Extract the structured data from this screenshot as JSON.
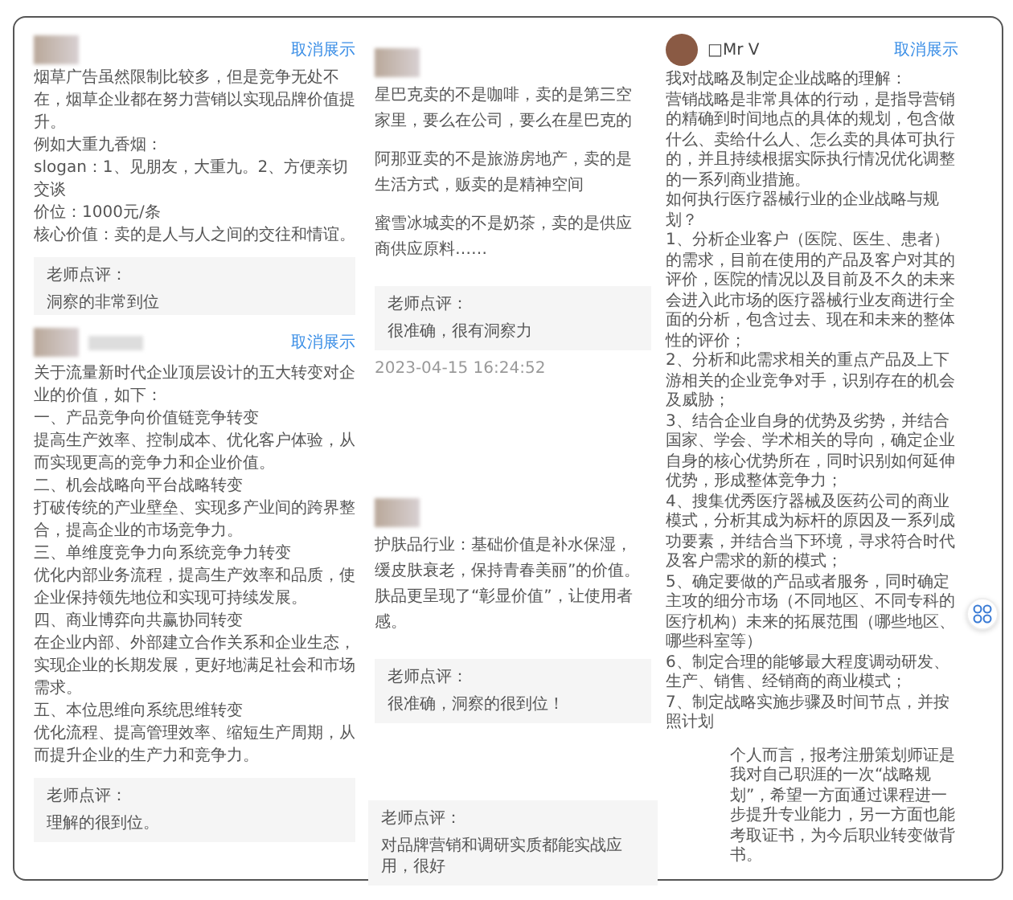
{
  "cards": [
    {
      "kind": "blurred",
      "name_blurred": false,
      "hide_link": "取消展示",
      "paragraphs": [
        "烟草广告虽然限制比较多，但是竞争无处不在，烟草企业都在努力营销以实现品牌价值提升。",
        "例如大重九香烟：",
        "slogan：1、见朋友，大重九。2、方便亲切交谈",
        "价位：1000元/条",
        "核心价值：卖的是人与人之间的交往和情谊。"
      ],
      "comment": {
        "label": "老师点评：",
        "text": "洞察的非常到位"
      }
    },
    {
      "kind": "blurred",
      "name_blurred": true,
      "hide_link": "取消展示",
      "paragraphs": [
        "关于流量新时代企业顶层设计的五大转变对企业的价值，如下：",
        "一、产品竞争向价值链竞争转变",
        "提高生产效率、控制成本、优化客户体验，从而实现更高的竞争力和企业价值。",
        "二、机会战略向平台战略转变",
        "打破传统的产业壁垒、实现多产业间的跨界整合，提高企业的市场竞争力。",
        "三、单维度竞争力向系统竞争力转变",
        "优化内部业务流程，提高生产效率和品质，使企业保持领先地位和实现可持续发展。",
        "四、商业博弈向共赢协同转变",
        "在企业内部、外部建立合作关系和企业生态，实现企业的长期发展，更好地满足社会和市场需求。",
        "五、本位思维向系统思维转变",
        "优化流程、提高管理效率、缩短生产周期，从而提升企业的生产力和竞争力。"
      ],
      "comment": {
        "label": "老师点评：",
        "text": "理解的很到位。"
      }
    },
    {
      "kind": "blurred",
      "name_blurred": false,
      "line_groups": [
        [
          "星巴克卖的不是咖啡，卖的是第三空",
          "家里，要么在公司，要么在星巴克的"
        ],
        [
          "阿那亚卖的不是旅游房地产，卖的是",
          "生活方式，贩卖的是精神空间"
        ],
        [
          "蜜雪冰城卖的不是奶茶，卖的是供应",
          "商供应原料……"
        ]
      ],
      "comment": {
        "label": "老师点评：",
        "text": "很准确，很有洞察力"
      },
      "time": "2023-04-15 16:24:52"
    },
    {
      "kind": "blurred",
      "name_blurred": false,
      "line_groups": [
        [
          "护肤品行业：基础价值是补水保湿，",
          "缓皮肤衰老，保持青春美丽”的价值。",
          "肤品更呈现了“彰显价值”，让使用者",
          "感。"
        ]
      ],
      "comment": {
        "label": "老师点评：",
        "text": "很准确，洞察的很到位！"
      }
    },
    {
      "kind": "photo",
      "name_blurred": false,
      "author": "□Mr V",
      "hide_link": "取消展示",
      "paragraphs": [
        "我对战略及制定企业战略的理解：",
        "营销战略是非常具体的行动，是指导营销的精确到时间地点的具体的规划，包含做什么、卖给什么人、怎么卖的具体可执行的，并且持续根据实际执行情况优化调整的一系列商业措施。",
        "如何执行医疗器械行业的企业战略与规划？",
        "1、分析企业客户（医院、医生、患者）的需求，目前在使用的产品及客户对其的评价，医院的情况以及目前及不久的未来会进入此市场的医疗器械行业友商进行全面的分析，包含过去、现在和未来的整体性的评价；",
        "2、分析和此需求相关的重点产品及上下游相关的企业竞争对手，识别存在的机会及威胁；",
        "3、结合企业自身的优势及劣势，并结合国家、学会、学术相关的导向，确定企业自身的核心优势所在，同时识别如何延伸优势，形成整体竞争力；",
        "4、搜集优秀医疗器械及医药公司的商业模式，分析其成为标杆的原因及一系列成功要素，并结合当下环境，寻求符合时代及客户需求的新的模式；",
        "5、确定要做的产品或者服务，同时确定主攻的细分市场（不同地区、不同专科的医疗机构）未来的拓展范围（哪些地区、哪些科室等）",
        "6、制定合理的能够最大程度调动研发、生产、销售、经销商的商业模式；",
        "7、制定战略实施步骤及时间节点，并按照计划"
      ]
    }
  ],
  "extra_comment": {
    "label": "老师点评：",
    "text": "对品牌营销和调研实质都能实战应用，很好"
  },
  "excerpt": {
    "text": "个人而言，报考注册策划师证是我对自己职涯的一次“战略规划”，希望一方面通过课程进一步提升专业能力，另一方面也能考取证书，为今后职业转变做背书。"
  }
}
